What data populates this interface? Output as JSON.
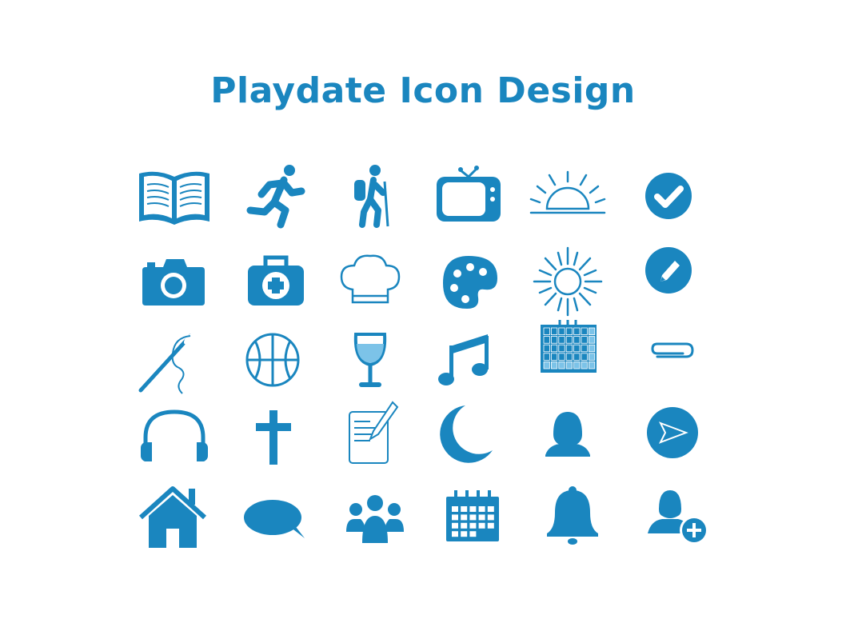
{
  "page": {
    "title": "Playdate Icon Design",
    "accent_color": "#1a86bf",
    "light_accent_color": "#7cc3e8",
    "background_color": "#ffffff"
  },
  "icons": [
    "open-book-icon",
    "running-person-icon",
    "hiker-icon",
    "tv-icon",
    "sunrise-icon",
    "check-circle-icon",
    "camera-icon",
    "first-aid-kit-icon",
    "chef-hat-icon",
    "paint-palette-icon",
    "sun-icon",
    "pencil-circle-icon",
    "needle-thread-icon",
    "basketball-icon",
    "wine-glass-icon",
    "music-note-icon",
    "calendar-grid-icon",
    "paperclip-icon",
    "headphones-icon",
    "cross-icon",
    "notepad-pencil-icon",
    "crescent-moon-icon",
    "woman-avatar-icon",
    "send-circle-icon",
    "home-icon",
    "speech-bubble-icon",
    "group-icon",
    "calendar-icon",
    "bell-icon",
    "add-user-icon"
  ]
}
